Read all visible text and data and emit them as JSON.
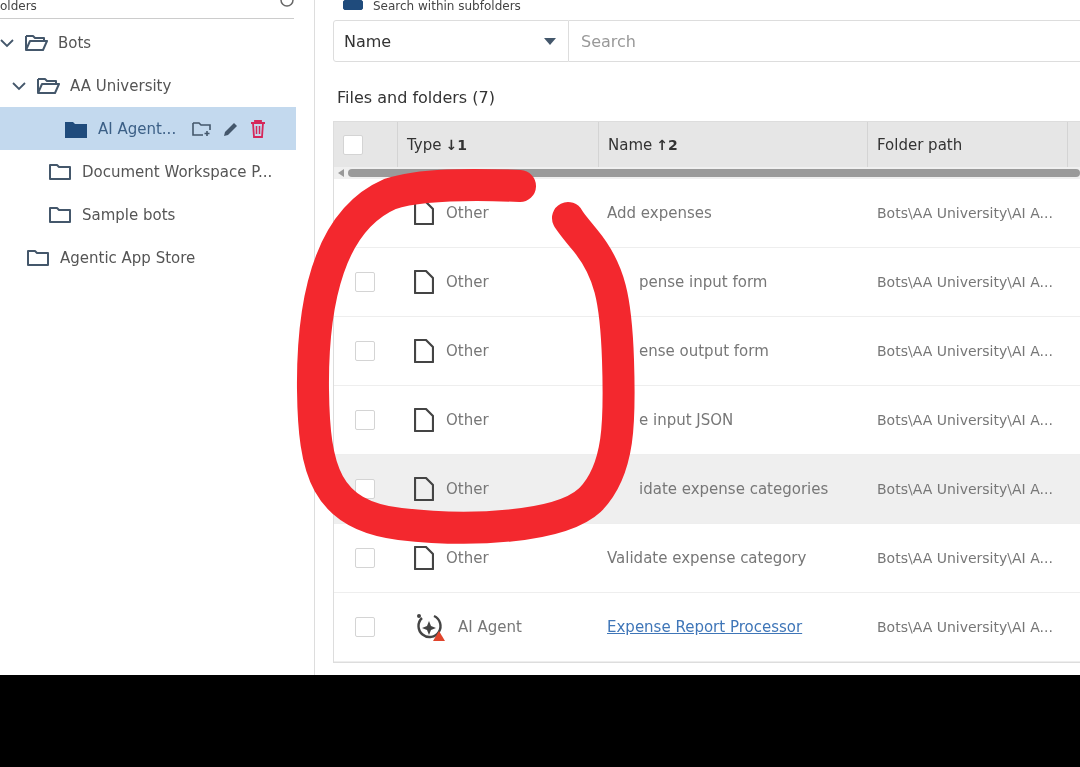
{
  "sidebar": {
    "title": "olders",
    "tree": [
      {
        "label": "Bots",
        "expanded": true,
        "selected": false,
        "children": [
          {
            "label": "AA University",
            "expanded": true,
            "selected": false,
            "children": [
              {
                "label": "AI Agent...",
                "selected": true
              }
            ]
          },
          {
            "label": "Document Workspace P...",
            "selected": false
          },
          {
            "label": "Sample bots",
            "selected": false
          }
        ]
      },
      {
        "label": "Agentic App Store",
        "selected": false
      }
    ]
  },
  "subfolders": {
    "label": "Search within subfolders",
    "checked": true
  },
  "filter": {
    "field": "Name",
    "placeholder": "Search"
  },
  "list_title": "Files and folders (7)",
  "table": {
    "select_all": {
      "checked": false
    },
    "columns": [
      {
        "label": "Type",
        "sort": "↓1"
      },
      {
        "label": "Name",
        "sort": "↑2"
      },
      {
        "label": "Folder path"
      }
    ],
    "rows": [
      {
        "kind": "other",
        "type": "Other",
        "name": "Add expenses",
        "cut": false,
        "hovered": false,
        "path": "Bots\\AA University\\AI A..."
      },
      {
        "kind": "other",
        "type": "Other",
        "name": "pense input form",
        "cut": true,
        "checked": false,
        "hovered": false,
        "path": "Bots\\AA University\\AI A..."
      },
      {
        "kind": "other",
        "type": "Other",
        "name": "ense output form",
        "cut": true,
        "checked": false,
        "hovered": false,
        "path": "Bots\\AA University\\AI A..."
      },
      {
        "kind": "other",
        "type": "Other",
        "name": "e input JSON",
        "cut": true,
        "checked": false,
        "hovered": false,
        "path": "Bots\\AA University\\AI A..."
      },
      {
        "kind": "other",
        "type": "Other",
        "name": "idate expense categories",
        "cut": true,
        "checked": false,
        "hovered": true,
        "path": "Bots\\AA University\\AI A..."
      },
      {
        "kind": "other",
        "type": "Other",
        "name": "Validate expense category",
        "cut": false,
        "checked": false,
        "hovered": false,
        "path": "Bots\\AA University\\AI A..."
      },
      {
        "kind": "agent",
        "type": "AI Agent",
        "name": "Expense Report Processor",
        "cut": false,
        "checked": false,
        "hovered": false,
        "path": "Bots\\AA University\\AI A..."
      }
    ]
  },
  "annotation": {
    "kind": "circle"
  }
}
